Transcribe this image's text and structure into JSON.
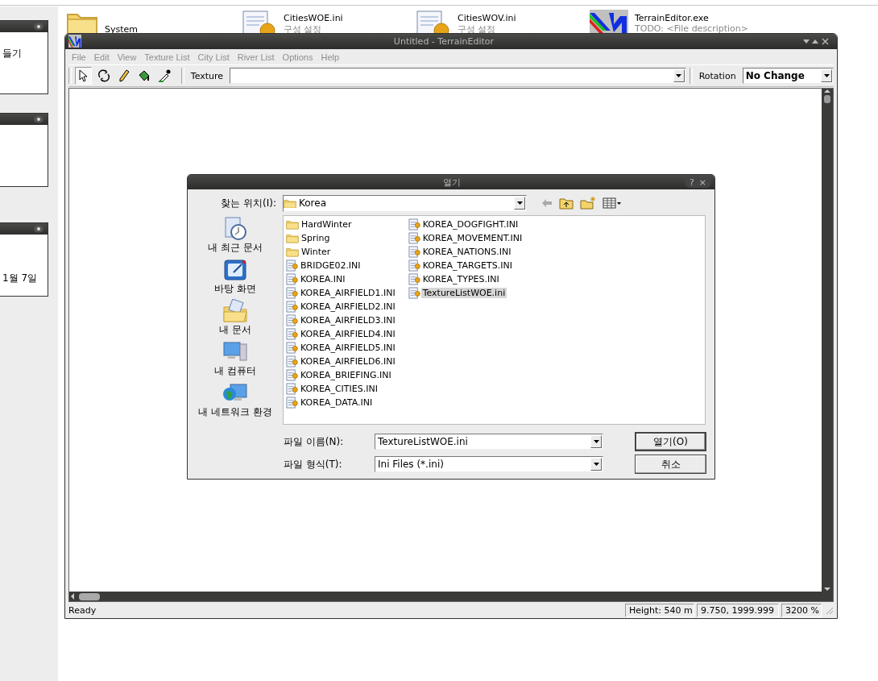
{
  "desktop": {
    "gadgets": [
      {
        "kind": "note",
        "text": "들기"
      },
      {
        "kind": "blank"
      },
      {
        "kind": "calendar",
        "text": "1월 7일"
      }
    ],
    "icons": [
      {
        "kind": "folder",
        "name": "System"
      },
      {
        "kind": "ini",
        "name": "CitiesWOE.ini",
        "description": "구성 설정"
      },
      {
        "kind": "ini",
        "name": "CitiesWOV.ini",
        "description": "구성 설정"
      },
      {
        "kind": "exe",
        "name": "TerrainEditor.exe",
        "description": "TODO: <File description>"
      }
    ]
  },
  "window": {
    "title": "Untitled - TerrainEditor",
    "menu": [
      {
        "label": "File",
        "disabled": true
      },
      {
        "label": "Edit",
        "disabled": true
      },
      {
        "label": "View",
        "disabled": true
      },
      {
        "label": "Texture List",
        "disabled": true
      },
      {
        "label": "City List",
        "disabled": true
      },
      {
        "label": "River List",
        "disabled": true
      },
      {
        "label": "Options",
        "disabled": true
      },
      {
        "label": "Help",
        "disabled": true
      }
    ],
    "tools": [
      {
        "kind": "pointer",
        "selected": true
      },
      {
        "kind": "rotate",
        "selected": false
      },
      {
        "kind": "pencil",
        "selected": false
      },
      {
        "kind": "fill",
        "selected": false
      },
      {
        "kind": "eyedropper",
        "selected": false
      }
    ],
    "texture_label": "Texture",
    "rotation_label": "Rotation",
    "rotation_value": "No Change",
    "status_bar": {
      "message": "Ready",
      "height": "Height: 540 m",
      "coordinates": "9.750, 1999.999",
      "zoom": "3200 %"
    }
  },
  "dialog": {
    "title": "열기",
    "title_buttons": [
      "?",
      "×"
    ],
    "look_in_label": "찾는 위치(I):",
    "look_in": "Korea",
    "places": [
      {
        "kind": "recent",
        "label": "내 최근 문서"
      },
      {
        "kind": "desktop",
        "label": "바탕 화면"
      },
      {
        "kind": "documents",
        "label": "내 문서"
      },
      {
        "kind": "computer",
        "label": "내 컴퓨터"
      },
      {
        "kind": "network",
        "label": "내 네트워크 환경"
      }
    ],
    "files": [
      {
        "kind": "folder",
        "name": "HardWinter",
        "selected": false
      },
      {
        "kind": "folder",
        "name": "Spring",
        "selected": false
      },
      {
        "kind": "folder",
        "name": "Winter",
        "selected": false
      },
      {
        "kind": "ini",
        "name": "BRIDGE02.INI",
        "selected": false
      },
      {
        "kind": "ini",
        "name": "KOREA.INI",
        "selected": false
      },
      {
        "kind": "ini",
        "name": "KOREA_AIRFIELD1.INI",
        "selected": false
      },
      {
        "kind": "ini",
        "name": "KOREA_AIRFIELD2.INI",
        "selected": false
      },
      {
        "kind": "ini",
        "name": "KOREA_AIRFIELD3.INI",
        "selected": false
      },
      {
        "kind": "ini",
        "name": "KOREA_AIRFIELD4.INI",
        "selected": false
      },
      {
        "kind": "ini",
        "name": "KOREA_AIRFIELD5.INI",
        "selected": false
      },
      {
        "kind": "ini",
        "name": "KOREA_AIRFIELD6.INI",
        "selected": false
      },
      {
        "kind": "ini",
        "name": "KOREA_BRIEFING.INI",
        "selected": false
      },
      {
        "kind": "ini",
        "name": "KOREA_CITIES.INI",
        "selected": false
      },
      {
        "kind": "ini",
        "name": "KOREA_DATA.INI",
        "selected": false
      },
      {
        "kind": "ini",
        "name": "KOREA_DOGFIGHT.INI",
        "selected": false
      },
      {
        "kind": "ini",
        "name": "KOREA_MOVEMENT.INI",
        "selected": false
      },
      {
        "kind": "ini",
        "name": "KOREA_NATIONS.INI",
        "selected": false
      },
      {
        "kind": "ini",
        "name": "KOREA_TARGETS.INI",
        "selected": false
      },
      {
        "kind": "ini",
        "name": "KOREA_TYPES.INI",
        "selected": false
      },
      {
        "kind": "ini",
        "name": "TextureListWOE.ini",
        "selected": true
      }
    ],
    "file_name_label": "파일 이름(N):",
    "file_name": "TextureListWOE.ini",
    "file_type_label": "파일 형식(T):",
    "file_type": "Ini Files (*.ini)",
    "buttons": [
      "열기(O)",
      "취소"
    ]
  }
}
